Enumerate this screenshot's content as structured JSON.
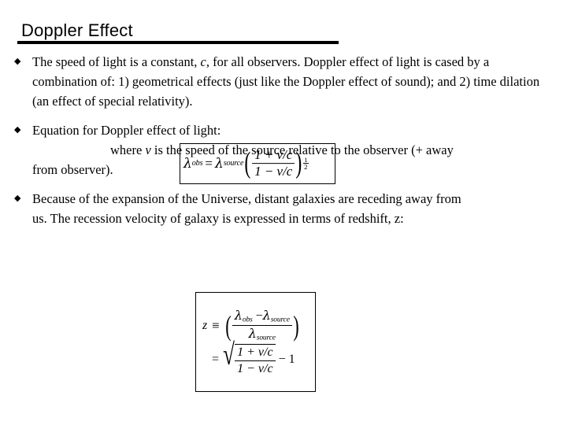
{
  "slide": {
    "title": "Doppler Effect",
    "bullet_marker": "◆",
    "bullets": [
      {
        "id": "speed-of-light",
        "lines": [
          "The speed of light is a constant, c, for all observers.  Doppler effect of light is cased by a combination of: 1) geometrical effects (just like the Doppler effect of sound); and 2) time dilation (an effect of special relativity)."
        ],
        "text_pre_italic": "The speed of light is a constant, ",
        "italic_symbol": "c",
        "text_post_italic": ", for all observers.  Doppler effect of light is cased by a combination of: 1) geometrical effects (just like the Doppler effect of sound); and 2) time dilation (an effect of special relativity)."
      },
      {
        "id": "doppler-equation",
        "line1": "Equation for Doppler effect of light:",
        "line2_pre_italic": "where ",
        "line2_italic": "v",
        "line2_post_italic": " is the speed of the source relative to the observer (+ away",
        "line3": "from observer)."
      },
      {
        "id": "redshift",
        "line1": "Because of the expansion of the Universe, distant galaxies are receding away from",
        "line2": "us.  The recession velocity of galaxy is expressed in terms of redshift, z:"
      }
    ],
    "equation_1": {
      "name": "doppler-wavelength-equation",
      "lhs": "λ",
      "lhs_sub": "obs",
      "equals": "=",
      "rhs_lambda": "λ",
      "rhs_sub": "source",
      "numerator": "1 + v/c",
      "denominator": "1 − v/c",
      "exponent_num": "1",
      "exponent_den": "2",
      "plain": "λ_obs = λ_source ((1 + v/c)/(1 − v/c))^(1/2)"
    },
    "equation_2": {
      "name": "redshift-equation",
      "z": "z",
      "equiv": "≡",
      "numerator": "λ_obs − λ_source",
      "num_lam1": "λ",
      "num_sub1": "obs",
      "num_minus": "−",
      "num_lam2": "λ",
      "num_sub2": "source",
      "den_lam": "λ",
      "den_sub": "source",
      "equals": "=",
      "radical_num": "1 + v/c",
      "radical_den": "1 − v/c",
      "minus_one": "− 1",
      "plain": "z ≡ (λ_obs − λ_source)/λ_source = sqrt((1 + v/c)/(1 − v/c)) − 1"
    }
  },
  "colors": {
    "background": "#ffffff",
    "text": "#000000",
    "rule": "#000000",
    "box_border": "#000000"
  }
}
